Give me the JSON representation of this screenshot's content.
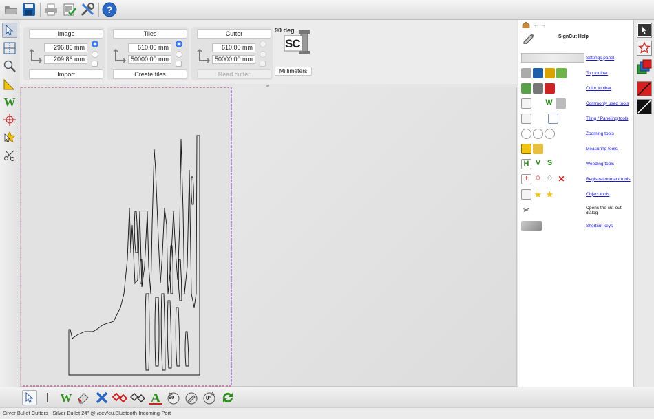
{
  "top_toolbar": {
    "icons": [
      "open-folder-icon",
      "save-icon",
      "print-icon",
      "checklist-icon",
      "tools-icon",
      "help-icon"
    ]
  },
  "left_toolbar": {
    "tools": [
      "pointer-tool",
      "tiling-tool",
      "zoom-tool",
      "measure-tool",
      "weed-tool",
      "registration-tool",
      "object-tool",
      "cut-out-tool"
    ]
  },
  "panels": {
    "image": {
      "title": "Image",
      "width": "296.86 mm",
      "height": "209.86 mm",
      "button": "Import"
    },
    "tiles": {
      "title": "Tiles",
      "width": "610.00 mm",
      "height": "50000.00 mm",
      "button": "Create tiles"
    },
    "cutter": {
      "title": "Cutter",
      "width": "610.00 mm",
      "height": "50000.00 mm",
      "button": "Read cutter"
    }
  },
  "rotation_label": "90 deg",
  "logo_text": "SC",
  "units_button": "Millimeters",
  "help": {
    "title": "SignCut Help",
    "items": [
      {
        "label": "Settings panel",
        "type": "link"
      },
      {
        "label": "Top toolbar",
        "type": "link"
      },
      {
        "label": "Color toolbar",
        "type": "link"
      },
      {
        "label": "Commonly used tools",
        "type": "link"
      },
      {
        "label": "Tiling / Paneling tools",
        "type": "link"
      },
      {
        "label": "Zooming tools",
        "type": "link"
      },
      {
        "label": "Measuring tools",
        "type": "link"
      },
      {
        "label": "Weeding tools",
        "type": "link"
      },
      {
        "label": "Registrationmark tools",
        "type": "link"
      },
      {
        "label": "Object tools",
        "type": "link"
      },
      {
        "label": "Opens the cut-out dialog",
        "type": "text"
      },
      {
        "label": "Shortcut keys",
        "type": "link"
      }
    ]
  },
  "bottom_toolbar": {
    "rotate_90_label": "90",
    "rotate_0_label": "0°"
  },
  "status_bar": "Silver Bullet Cutters - Silver Bullet 24\" @ /dev/cu.Bluetooth-Incoming-Port",
  "colors": {
    "link": "#1a1acc",
    "radio_selected": "#3a82f7",
    "weed_green": "#2f8f1f",
    "red": "#d62020"
  }
}
